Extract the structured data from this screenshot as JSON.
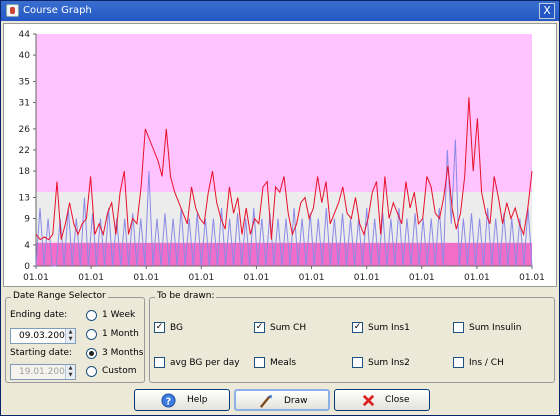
{
  "window": {
    "title": "Course Graph",
    "close_glyph": "X"
  },
  "chart_data": {
    "type": "line",
    "yticks": [
      0,
      4,
      9,
      13,
      18,
      22,
      26,
      31,
      35,
      40,
      44
    ],
    "ylim": [
      0,
      44
    ],
    "x_tick_labels": [
      "01.01",
      "01.01",
      "01.01",
      "01.01",
      "01.01",
      "01.01",
      "01.01",
      "01.01",
      "01.01",
      "01.01"
    ],
    "bands": [
      {
        "name": "high",
        "from": 14,
        "to": 44,
        "color": "#ffc3ff"
      },
      {
        "name": "normal",
        "from": 4.4,
        "to": 14,
        "color": "#ececec"
      },
      {
        "name": "low",
        "from": 0,
        "to": 4.4,
        "color": "#f06ec8"
      }
    ],
    "bg_color": "#e8102a",
    "insulin_color": "#8a8ae8",
    "series": [
      {
        "key": "bg",
        "values": [
          6,
          5,
          5.5,
          5,
          6,
          16,
          5,
          8,
          12,
          8,
          6,
          8,
          9,
          17,
          6,
          8,
          6,
          10,
          12,
          6,
          14,
          18,
          6,
          9,
          8,
          15,
          26,
          24,
          22,
          20,
          17,
          26,
          17,
          14,
          12,
          10,
          8,
          15,
          11,
          9,
          8,
          14,
          18,
          12,
          9,
          7,
          15,
          10,
          13,
          6,
          11,
          6,
          9,
          8,
          15,
          16,
          5,
          15,
          14,
          17,
          10,
          6,
          8,
          12,
          13,
          9,
          11,
          17,
          12,
          16,
          8,
          10,
          12,
          15,
          10,
          9,
          13,
          8,
          6,
          9,
          14,
          16,
          6,
          17,
          9,
          12,
          10,
          8,
          16,
          11,
          14,
          8,
          9,
          17,
          15,
          10,
          9,
          13,
          19,
          11,
          7,
          10,
          17,
          32,
          18,
          28,
          14,
          10,
          8,
          17,
          13,
          8,
          12,
          9,
          11,
          8,
          6,
          11,
          18
        ]
      },
      {
        "key": "insulin",
        "values": [
          0,
          11,
          0,
          9,
          0,
          0,
          9,
          0,
          11,
          0,
          9,
          0,
          13,
          0,
          10,
          0,
          9,
          0,
          11,
          0,
          9,
          0,
          9,
          0,
          10,
          0,
          9,
          0,
          18,
          0,
          9,
          0,
          10,
          0,
          9,
          0,
          11,
          0,
          9,
          0,
          10,
          0,
          9,
          0,
          9,
          0,
          11,
          0,
          9,
          0,
          10,
          0,
          9,
          0,
          11,
          0,
          9,
          0,
          10,
          0,
          9,
          0,
          9,
          0,
          11,
          0,
          9,
          0,
          10,
          0,
          9,
          0,
          11,
          0,
          9,
          0,
          10,
          0,
          9,
          0,
          9,
          0,
          11,
          0,
          9,
          0,
          10,
          0,
          9,
          0,
          11,
          0,
          9,
          0,
          10,
          0,
          9,
          0,
          9,
          0,
          11,
          0,
          22,
          8,
          24,
          0,
          9,
          0,
          10,
          0,
          9,
          0,
          11,
          0,
          9,
          0,
          10,
          0,
          9,
          0,
          9,
          0,
          11,
          0
        ]
      }
    ]
  },
  "date_range": {
    "title": "Date Range Selector",
    "ending_label": "Ending date:",
    "ending_value": "09.03.2008",
    "starting_label": "Starting date:",
    "starting_value": "19.01.2008",
    "options": [
      {
        "label": "1 Week",
        "selected": false
      },
      {
        "label": "1 Month",
        "selected": false
      },
      {
        "label": "3 Months",
        "selected": true
      },
      {
        "label": "Custom",
        "selected": false
      }
    ]
  },
  "to_be_drawn": {
    "title": "To be drawn:",
    "items": [
      {
        "label": "BG",
        "checked": true
      },
      {
        "label": "Sum CH",
        "checked": true
      },
      {
        "label": "Sum Ins1",
        "checked": true
      },
      {
        "label": "Sum Insulin",
        "checked": false
      },
      {
        "label": "avg BG per day",
        "checked": false
      },
      {
        "label": "Meals",
        "checked": false
      },
      {
        "label": "Sum Ins2",
        "checked": false
      },
      {
        "label": "Ins / CH",
        "checked": false
      }
    ]
  },
  "buttons": {
    "help": "Help",
    "draw": "Draw",
    "close": "Close"
  },
  "glyphs": {
    "check": "✓",
    "spin_up": "▲",
    "spin_down": "▼",
    "help_icon": "?"
  }
}
